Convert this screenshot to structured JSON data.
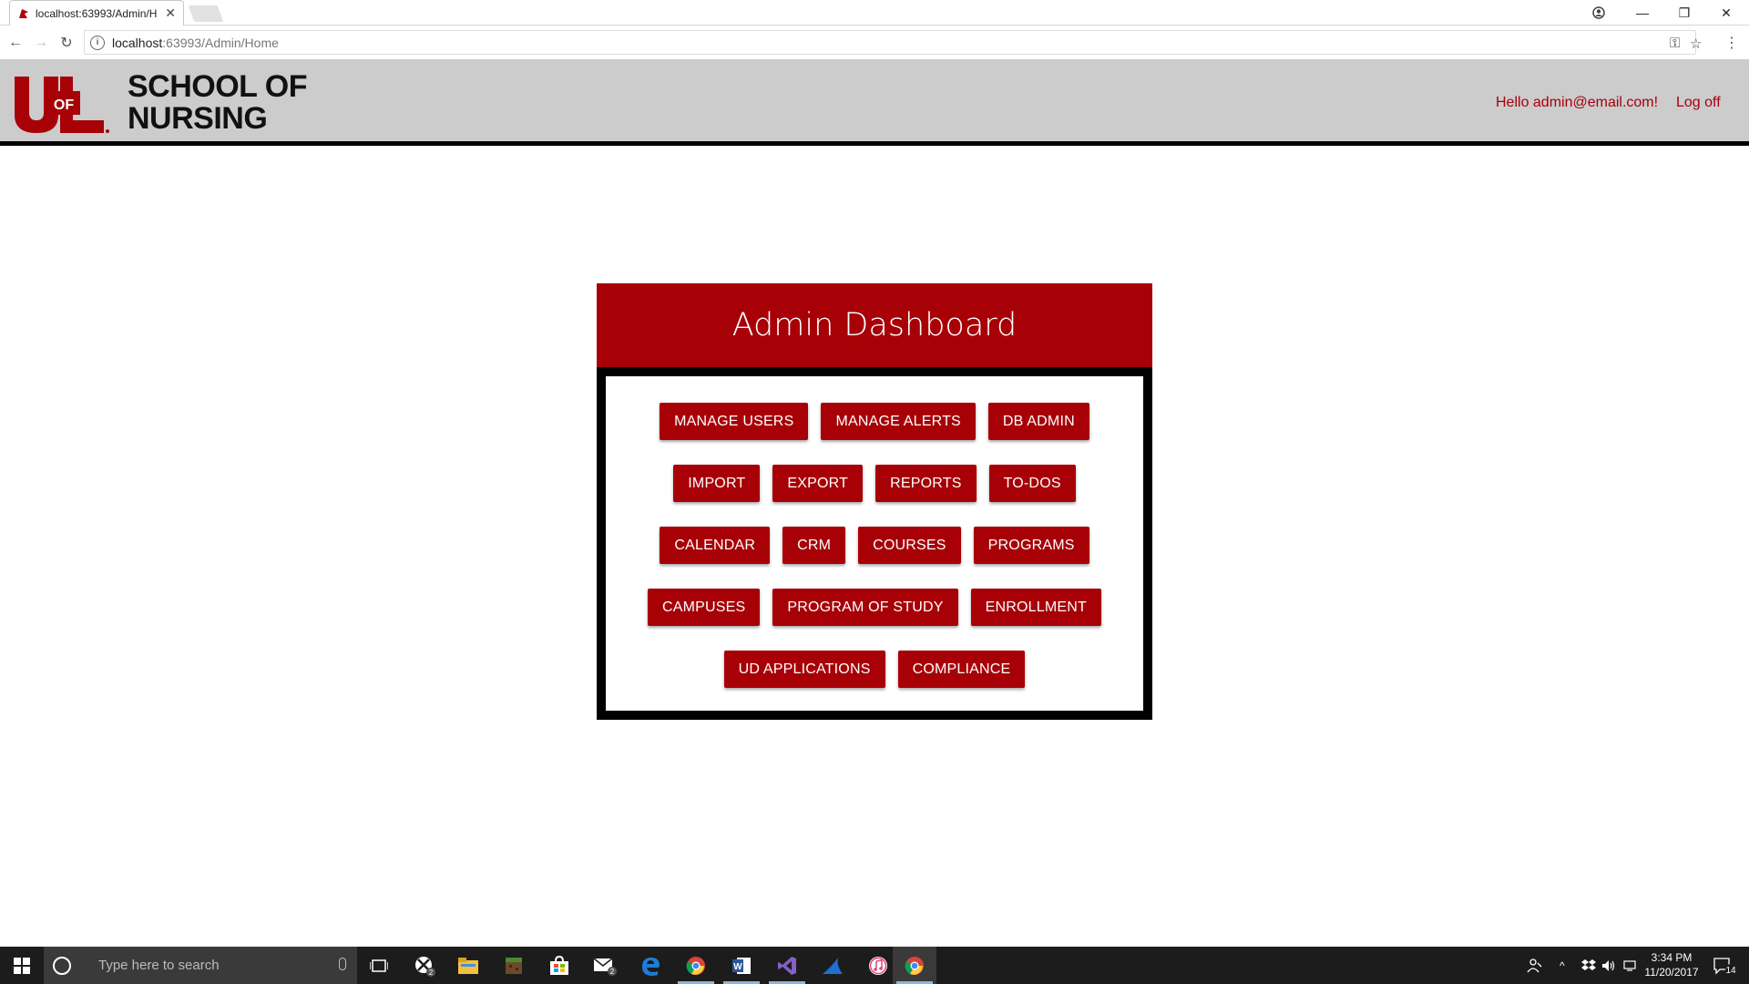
{
  "browser": {
    "tab_title": "localhost:63993/Admin/H",
    "url_host": "localhost",
    "url_rest": ":63993/Admin/Home"
  },
  "header": {
    "logo_text_top": "UL",
    "logo_text_of": "OF",
    "school_line1": "SCHOOL OF",
    "school_line2": "NURSING",
    "greeting": "Hello admin@email.com!",
    "logoff": "Log off"
  },
  "dashboard": {
    "title": "Admin Dashboard",
    "rows": [
      [
        "MANAGE USERS",
        "MANAGE ALERTS",
        "DB ADMIN"
      ],
      [
        "IMPORT",
        "EXPORT",
        "REPORTS",
        "TO-DOS"
      ],
      [
        "CALENDAR",
        "CRM",
        "COURSES",
        "PROGRAMS"
      ],
      [
        "CAMPUSES",
        "PROGRAM OF STUDY",
        "ENROLLMENT"
      ],
      [
        "UD APPLICATIONS",
        "COMPLIANCE"
      ]
    ]
  },
  "taskbar": {
    "search_placeholder": "Type here to search",
    "time": "3:34 PM",
    "date": "11/20/2017",
    "notification_count": "14",
    "xbox_badge": "2",
    "mail_badge": "2"
  },
  "colors": {
    "brand_red": "#a80007",
    "header_gray": "#cccccc",
    "link_red": "#a4000c"
  }
}
